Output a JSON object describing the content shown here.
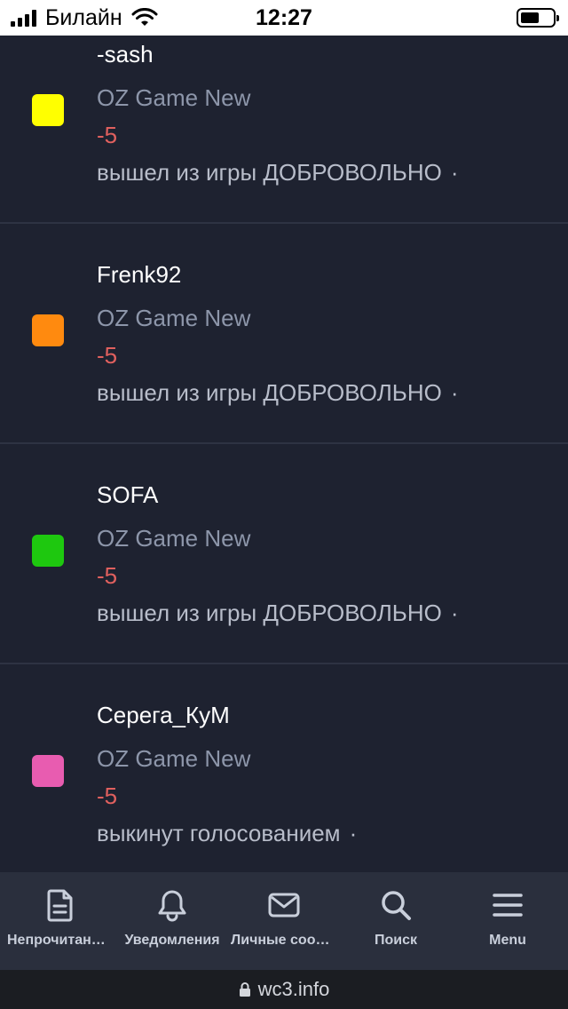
{
  "status_bar": {
    "carrier": "Билайн",
    "time": "12:27"
  },
  "entries": [
    {
      "name": "-sash",
      "game": "OZ Game New",
      "score": "-5",
      "reason": "вышел из игры ДОБРОВОЛЬНО",
      "color": "#ffff00"
    },
    {
      "name": "Frenk92",
      "game": "OZ Game New",
      "score": "-5",
      "reason": "вышел из игры ДОБРОВОЛЬНО",
      "color": "#ff8a0f"
    },
    {
      "name": "SOFA",
      "game": "OZ Game New",
      "score": "-5",
      "reason": "вышел из игры ДОБРОВОЛЬНО",
      "color": "#1ec80f"
    },
    {
      "name": "Серега_КуМ",
      "game": "OZ Game New",
      "score": "-5",
      "reason": "выкинут голосованием",
      "color": "#e85cb0"
    }
  ],
  "separator": "·",
  "tab_bar": {
    "tabs": [
      {
        "label": "Непрочитанные",
        "icon": "document-icon"
      },
      {
        "label": "Уведомления",
        "icon": "bell-icon"
      },
      {
        "label": "Личные сообщения",
        "icon": "envelope-icon"
      },
      {
        "label": "Поиск",
        "icon": "search-icon"
      },
      {
        "label": "Menu",
        "icon": "hamburger-menu-icon"
      }
    ]
  },
  "browser": {
    "url": "wc3.info",
    "lock_icon": "lock-icon"
  }
}
